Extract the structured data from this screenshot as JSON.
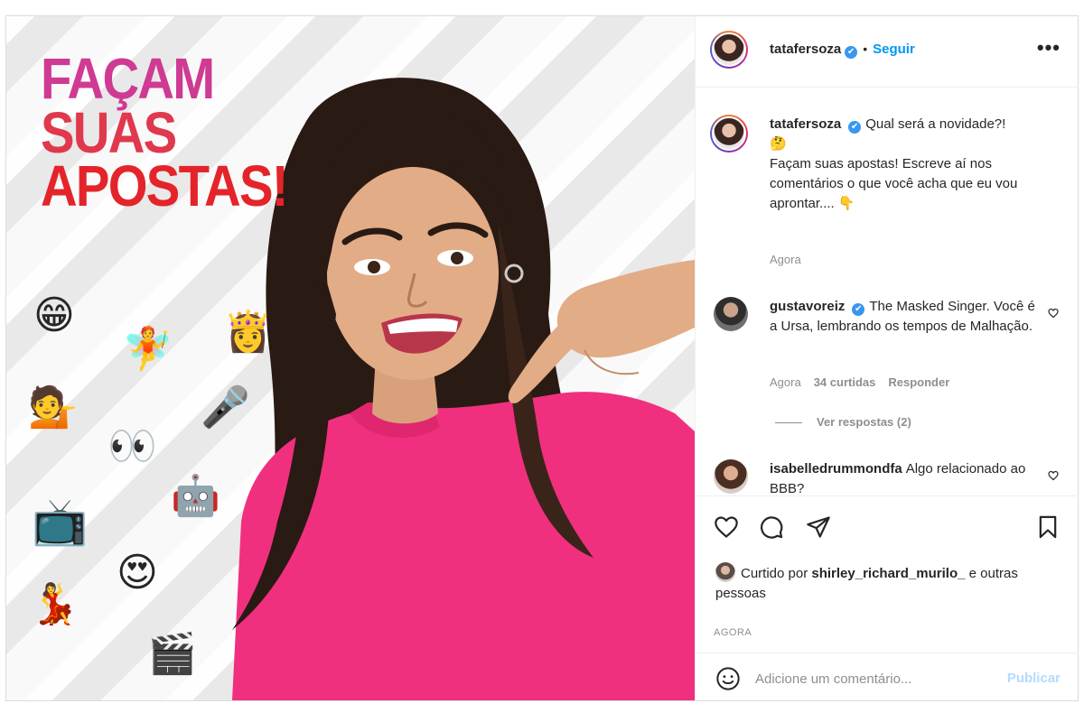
{
  "media": {
    "headline": [
      "FAÇAM",
      "SUAS",
      "APOSTAS!"
    ],
    "emojis": [
      {
        "name": "grinning-face-emoji",
        "glyph": "😁"
      },
      {
        "name": "fairy-emoji",
        "glyph": "🧚"
      },
      {
        "name": "princess-emoji",
        "glyph": "👸"
      },
      {
        "name": "woman-tipping-hand-emoji",
        "glyph": "💁"
      },
      {
        "name": "microphone-emoji",
        "glyph": "🎤"
      },
      {
        "name": "eyes-emoji",
        "glyph": "👀"
      },
      {
        "name": "robot-emoji",
        "glyph": "🤖"
      },
      {
        "name": "television-emoji",
        "glyph": "📺"
      },
      {
        "name": "heart-eyes-emoji",
        "glyph": "😍"
      },
      {
        "name": "dancer-emoji",
        "glyph": "💃"
      },
      {
        "name": "clapper-board-emoji",
        "glyph": "🎬"
      }
    ],
    "colors": {
      "shirt": "#f0307e",
      "headline_pink": "#cf3a93",
      "headline_red": "#e4242b"
    }
  },
  "header": {
    "username": "tatafersoza",
    "verified_icon": "✔",
    "separator": "•",
    "follow_label": "Seguir",
    "more_label": "•••"
  },
  "caption": {
    "username": "tatafersoza",
    "text_line1": "Qual será a novidade?!",
    "emoji1": "🤔",
    "text_line2": "Façam suas apostas! Escreve aí nos comentários o que você acha que eu vou aprontar.... 👇",
    "time": "Agora"
  },
  "comments": [
    {
      "username": "gustavoreiz",
      "verified": true,
      "text": "The Masked Singer. Você é a Ursa, lembrando os tempos de Malhação.",
      "time": "Agora",
      "likes": "34 curtidas",
      "reply_label": "Responder",
      "view_replies": "Ver respostas (2)"
    },
    {
      "username": "isabelledrummondfa",
      "verified": false,
      "text": "Algo relacionado ao BBB?"
    }
  ],
  "liked_by": {
    "prefix": "Curtido por",
    "user": "shirley_richard_murilo_",
    "suffix": "e outras pessoas"
  },
  "timestamp": "AGORA",
  "add_comment": {
    "placeholder": "Adicione um comentário...",
    "publish_label": "Publicar"
  },
  "accent_color": "#0095f6"
}
